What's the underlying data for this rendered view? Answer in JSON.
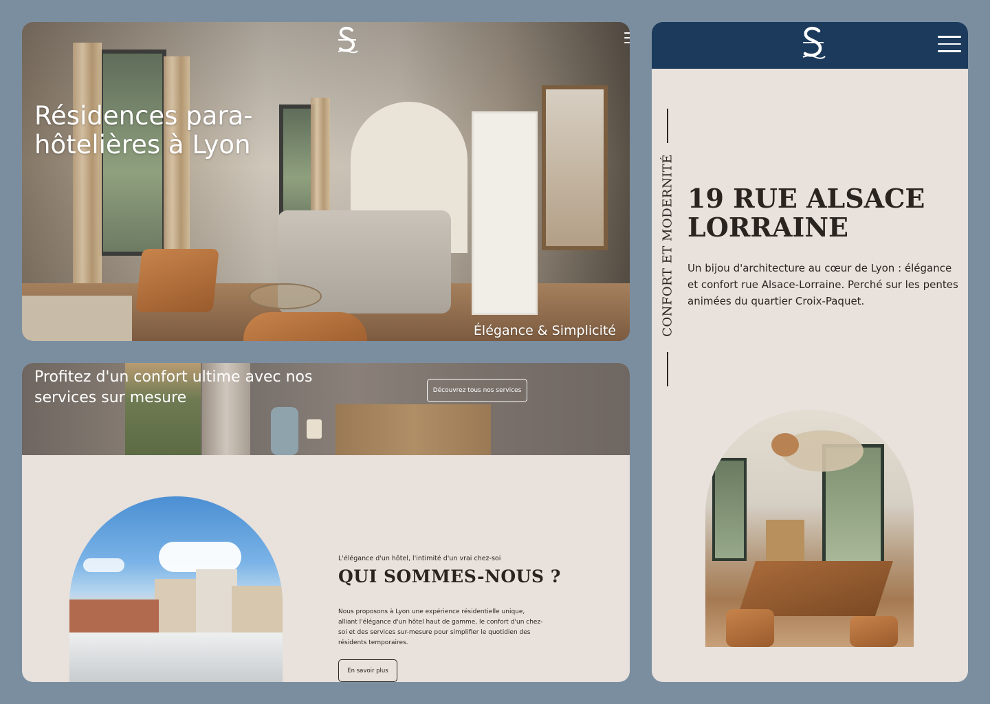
{
  "hero": {
    "title": "Résidences para-hôtelières à Lyon",
    "tagline": "Élégance & Simplicité",
    "logo_icon": "ornate-s-logo-icon",
    "menu_icon": "hamburger-menu-icon"
  },
  "services": {
    "title": "Profitez d'un confort ultime avec nos services sur mesure",
    "button_label": "Découvrez tous nos services"
  },
  "about": {
    "kicker": "L'élégance d'un hôtel, l'intimité d'un vrai chez-soi",
    "heading": "QUI SOMMES-NOUS ?",
    "text": "Nous proposons à Lyon une expérience résidentielle unique, alliant l'élégance d'un hôtel haut de gamme, le confort d'un chez-soi et des services sur-mesure pour simplifier le quotidien des résidents temporaires.",
    "button_label": "En savoir plus"
  },
  "mobile": {
    "logo_icon": "ornate-s-logo-icon",
    "menu_icon": "hamburger-menu-icon",
    "vertical_label": "CONFORT ET MODERNITÉ",
    "title": "19 RUE ALSACE LORRAINE",
    "text": "Un bijou d'architecture au cœur de Lyon : élégance et confort rue Alsace-Lorraine. Perché sur les pentes animées du quartier Croix-Paquet."
  },
  "colors": {
    "page_bg": "#7b8ea0",
    "cream": "#e8e1dc",
    "navy": "#1b3a5c",
    "text_dark": "#2a2420"
  }
}
